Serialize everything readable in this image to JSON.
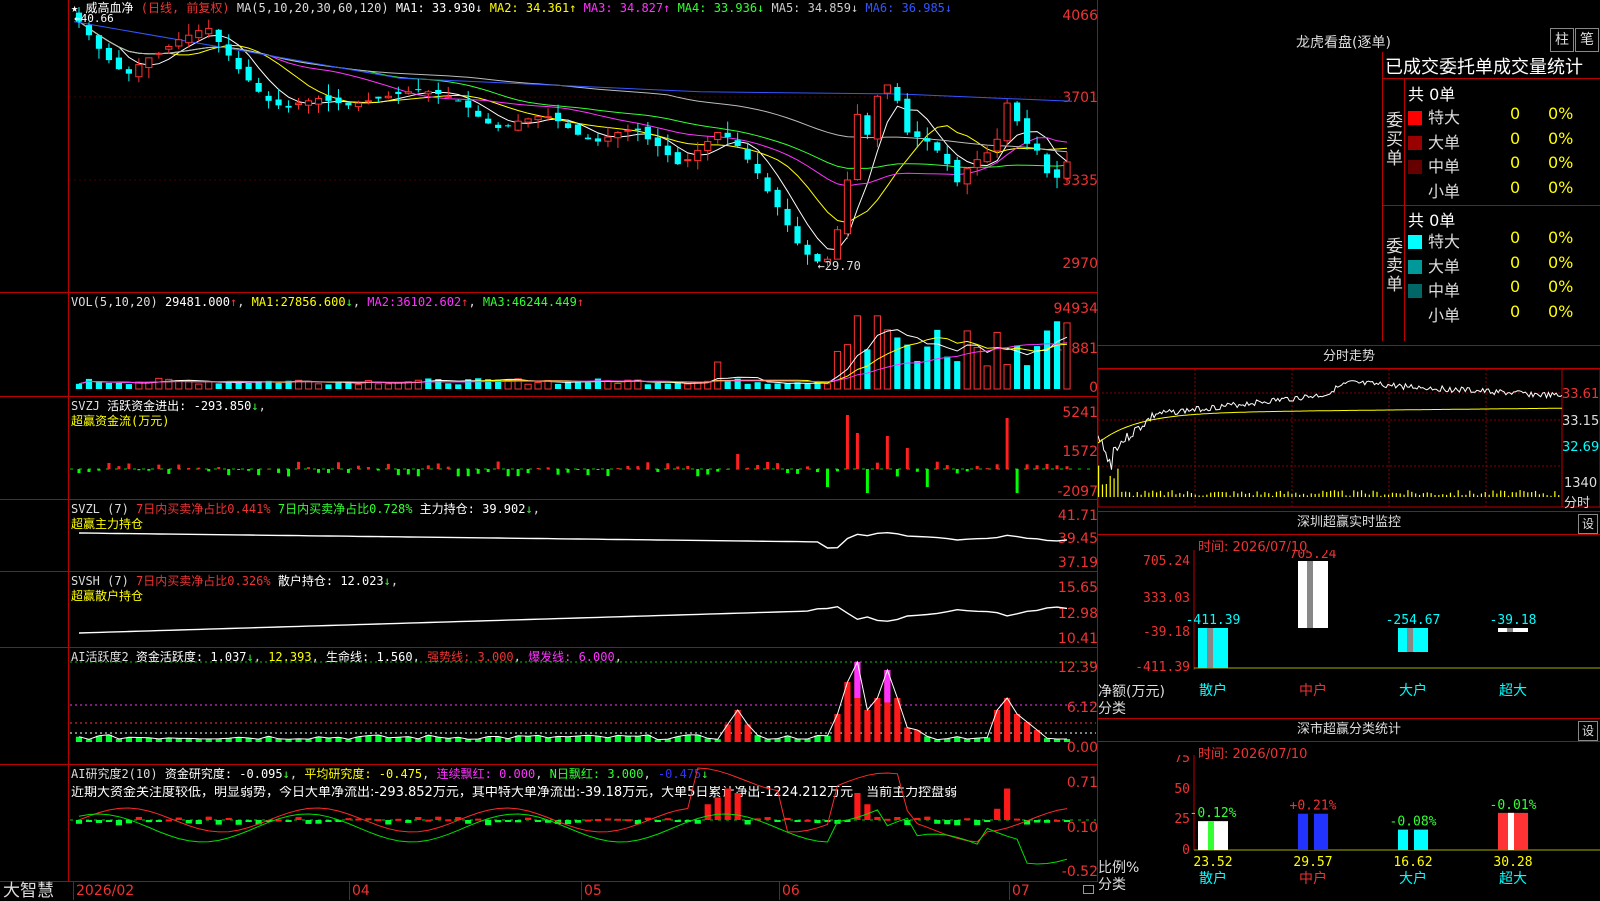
{
  "app": {
    "brand": "大智慧"
  },
  "stock": {
    "name": "威高血净",
    "period": "(日线, 前复权)"
  },
  "ma_line": {
    "label": "MA(5,10,20,30,60,120)",
    "items": [
      {
        "label": "MA1:",
        "value": "33.930",
        "arrow": "↓",
        "color": "#ffffff"
      },
      {
        "label": "MA2:",
        "value": "34.361",
        "arrow": "↑",
        "color": "#ffff00"
      },
      {
        "label": "MA3:",
        "value": "34.827",
        "arrow": "↑",
        "color": "#ff33ff"
      },
      {
        "label": "MA4:",
        "value": "33.936",
        "arrow": "↓",
        "color": "#33ff33"
      },
      {
        "label": "MA5:",
        "value": "34.859",
        "arrow": "↓",
        "color": "#cccccc"
      },
      {
        "label": "MA6:",
        "value": "36.985",
        "arrow": "↓",
        "color": "#3355ff"
      }
    ]
  },
  "price_axis": [
    "4066",
    "3701",
    "3335",
    "2970"
  ],
  "price_marks": {
    "high": "40.66",
    "low": "29.70"
  },
  "vol": {
    "label": "VOL(5,10,20)",
    "value": "29481.000",
    "ma1": "27856.600",
    "ma2": "36102.602",
    "ma3": "46244.449",
    "axis": [
      "94934",
      "46881",
      "0"
    ]
  },
  "svzj": {
    "label": "SVZJ",
    "name": "活跃资金进出:",
    "value": "-293.850",
    "subtitle": "超赢资金流(万元)",
    "axis": [
      "5241",
      "1572",
      "-2097"
    ]
  },
  "svzl": {
    "label": "SVZL (7)",
    "t1": "7日内买卖净占比0.441%",
    "t2": "7日内买卖净占比0.728%",
    "t3": "主力持仓:",
    "value": "39.902",
    "subtitle": "超赢主力持仓",
    "axis": [
      "41.71",
      "39.45",
      "37.19"
    ]
  },
  "svsh": {
    "label": "SVSH (7)",
    "t1": "7日内买卖净占比0.326%",
    "t3": "散户持仓:",
    "value": "12.023",
    "subtitle": "超赢散户持仓",
    "axis": [
      "15.65",
      "12.98",
      "10.41"
    ]
  },
  "ai_active": {
    "label": "AI活跃度2",
    "t1": "资金活跃度:",
    "v1": "1.037",
    "v2": "12.393",
    "t3": "生命线:",
    "v3": "1.560",
    "t4": "强势线:",
    "v4": "3.000",
    "t5": "爆发线:",
    "v5": "6.000",
    "axis": [
      "12.39",
      "6.12",
      "0.00"
    ]
  },
  "ai_research": {
    "label": "AI研究度2(10)",
    "t1": "资金研究度:",
    "v1": "-0.095",
    "t2": "平均研究度:",
    "v2": "-0.475",
    "t3": "连续飘红:",
    "v3": "0.000",
    "t4": "N日飘红:",
    "v4": "3.000",
    "v5": "-0.475",
    "comment": "近期大资金关注度较低，明显弱势，今日大单净流出:-293.852万元，其中特大单净流出:-39.18万元，大单5日累计净出-1224.212万元，当前主力控盘弱",
    "axis": [
      "0.71",
      "0.10",
      "-0.52"
    ]
  },
  "date_axis": [
    "2026/02",
    "04",
    "05",
    "06",
    "07"
  ],
  "dragon": {
    "title": "龙虎看盘(逐单)",
    "btn1": "柱",
    "btn2": "笔",
    "tabs": "已成交委托单成交量统计",
    "buy": {
      "side": "委买单",
      "total": "共 0单",
      "rows": [
        {
          "name": "特大",
          "count": "0",
          "pct": "0%",
          "color": "#ff0000"
        },
        {
          "name": "大单",
          "count": "0",
          "pct": "0%",
          "color": "#990000"
        },
        {
          "name": "中单",
          "count": "0",
          "pct": "0%",
          "color": "#660000"
        },
        {
          "name": "小单",
          "count": "0",
          "pct": "0%",
          "color": "#000000"
        }
      ]
    },
    "sell": {
      "side": "委卖单",
      "total": "共 0单",
      "rows": [
        {
          "name": "特大",
          "count": "0",
          "pct": "0%",
          "color": "#00ffff"
        },
        {
          "name": "大单",
          "count": "0",
          "pct": "0%",
          "color": "#009999"
        },
        {
          "name": "中单",
          "count": "0",
          "pct": "0%",
          "color": "#006666"
        },
        {
          "name": "小单",
          "count": "0",
          "pct": "0%",
          "color": "#000000"
        }
      ]
    }
  },
  "intraday": {
    "title": "分时走势",
    "axis": [
      "33.61",
      "33.15",
      "32.69"
    ],
    "vol_axis": "1340",
    "vol_unit": "分时"
  },
  "monitor": {
    "title": "深圳超赢实时监控",
    "date": "时间: 2026/07/10",
    "set": "设",
    "axis": [
      "705.24",
      "333.03",
      "-39.18",
      "-411.39"
    ],
    "ylabel": "净额(万元)",
    "xlabel": "分类",
    "cats": [
      "散户",
      "中户",
      "大户",
      "超大"
    ],
    "values": [
      -411.39,
      705.24,
      -254.67,
      -39.18
    ],
    "labels": [
      "-411.39",
      "705.24",
      "-254.67",
      "-39.18"
    ]
  },
  "classify": {
    "title": "深市超赢分类统计",
    "date": "时间: 2026/07/10",
    "set": "设",
    "axis": [
      "75",
      "50",
      "25",
      "0"
    ],
    "ylabel": "比例%",
    "xlabel": "分类",
    "cats": [
      "散户",
      "中户",
      "大户",
      "超大"
    ],
    "values": [
      23.52,
      29.57,
      16.62,
      30.28
    ],
    "deltas": [
      "-0.12%",
      "+0.21%",
      "-0.08%",
      "-0.01%"
    ],
    "labels": [
      "23.52",
      "29.57",
      "16.62",
      "30.28"
    ]
  },
  "chart_data": [
    {
      "type": "candlestick",
      "title": "威高血净 (日线, 前复权)",
      "ylim": [
        29.7,
        40.66
      ],
      "high": 40.66,
      "low": 29.7,
      "ma": {
        "MA1": 33.93,
        "MA2": 34.361,
        "MA3": 34.827,
        "MA4": 33.936,
        "MA5": 34.859,
        "MA6": 36.985
      },
      "closes": [
        40.5,
        39.9,
        39.3,
        38.8,
        38.4,
        38.2,
        38.6,
        38.9,
        39.1,
        39.4,
        39.7,
        39.9,
        40.1,
        40.2,
        39.6,
        39.0,
        38.4,
        37.9,
        37.4,
        37.0,
        36.8,
        36.7,
        36.9,
        37.0,
        37.1,
        37.0,
        36.9,
        36.8,
        36.9,
        37.0,
        37.1,
        37.2,
        37.3,
        37.4,
        37.5,
        37.4,
        37.3,
        37.2,
        37.0,
        36.7,
        36.3,
        36.0,
        35.8,
        35.9,
        36.1,
        36.2,
        36.3,
        36.3,
        36.1,
        35.8,
        35.5,
        35.3,
        35.2,
        35.4,
        35.6,
        35.7,
        35.7,
        35.3,
        35.0,
        34.6,
        34.2,
        34.4,
        34.8,
        35.2,
        35.6,
        35.4,
        35.0,
        34.4,
        33.8,
        33.0,
        32.3,
        31.5,
        30.7,
        30.2,
        29.9,
        30.0,
        31.3,
        33.5,
        36.4,
        35.5,
        37.2,
        37.7,
        37.0,
        35.6,
        35.4,
        35.2,
        34.8,
        34.2,
        33.4,
        34.0,
        34.4,
        34.7,
        35.3,
        36.9,
        36.1,
        35.1,
        34.8,
        33.8,
        33.6,
        34.3
      ]
    },
    {
      "type": "bar",
      "title": "深圳超赢实时监控",
      "categories": [
        "散户",
        "中户",
        "大户",
        "超大"
      ],
      "values": [
        -411.39,
        705.24,
        -254.67,
        -39.18
      ],
      "ylabel": "净额(万元)",
      "xlabel": "分类"
    },
    {
      "type": "bar",
      "title": "深市超赢分类统计",
      "categories": [
        "散户",
        "中户",
        "大户",
        "超大"
      ],
      "values": [
        23.52,
        29.57,
        16.62,
        30.28
      ],
      "ylabel": "比例%",
      "xlabel": "分类",
      "ylim": [
        0,
        75
      ]
    }
  ]
}
